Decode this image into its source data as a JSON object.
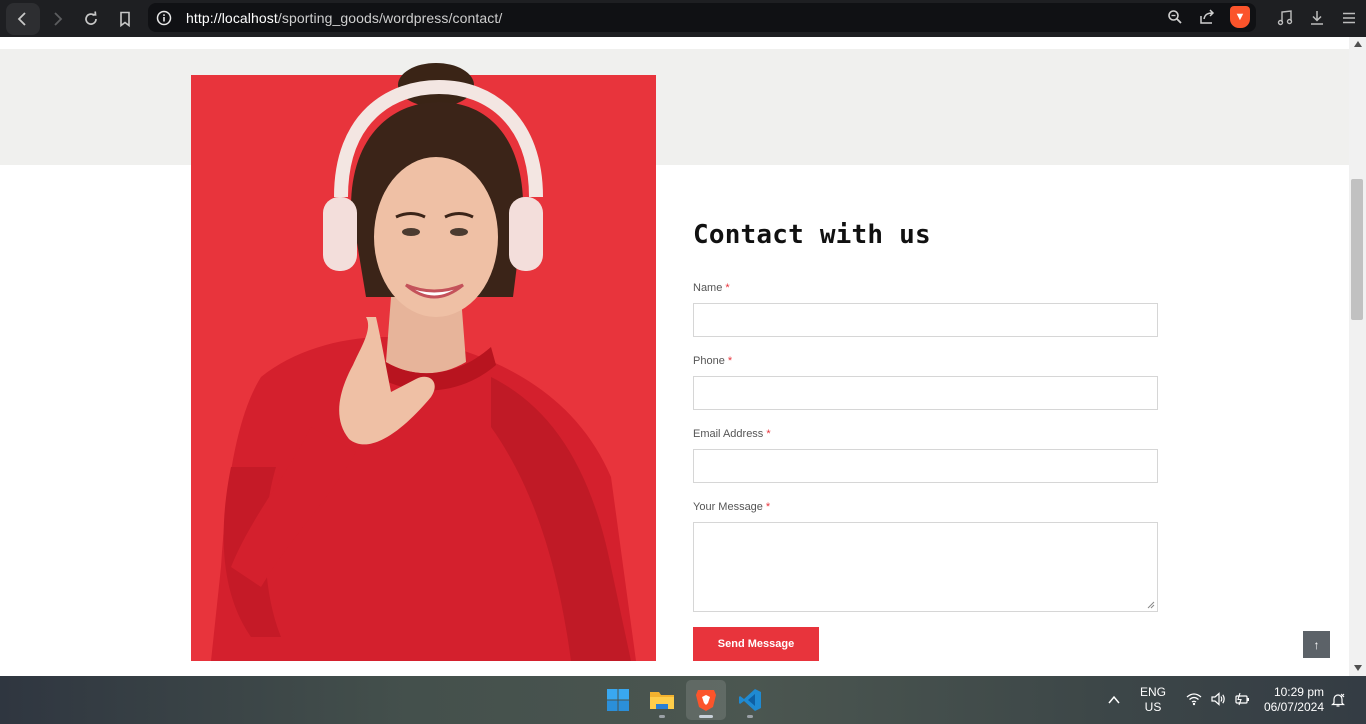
{
  "browser": {
    "url_host": "http://localhost",
    "url_path": "/sporting_goods/wordpress/contact/"
  },
  "contact": {
    "title": "Contact with us",
    "required_mark": "*",
    "fields": [
      {
        "label": "Name",
        "value": ""
      },
      {
        "label": "Phone",
        "value": ""
      },
      {
        "label": "Email Address",
        "value": ""
      },
      {
        "label": "Your Message",
        "value": ""
      }
    ],
    "submit_label": "Send Message"
  },
  "back_to_top": "↑",
  "colors": {
    "accent": "#e8343c",
    "grey_band": "#f0f0ee",
    "browser_bar": "#1e1f22"
  },
  "icons": [
    "back-icon",
    "forward-icon",
    "reload-icon",
    "bookmark-icon",
    "site-info-icon",
    "zoom-icon",
    "share-icon",
    "brave-shield-icon",
    "media-icon",
    "download-icon",
    "menu-icon",
    "windows-start-icon",
    "file-explorer-icon",
    "brave-browser-icon",
    "vscode-icon",
    "wifi-icon",
    "volume-icon",
    "battery-icon",
    "notification-icon"
  ],
  "taskbar": {
    "lang_line1": "ENG",
    "lang_line2": "US",
    "time": "10:29 pm",
    "date": "06/07/2024"
  }
}
